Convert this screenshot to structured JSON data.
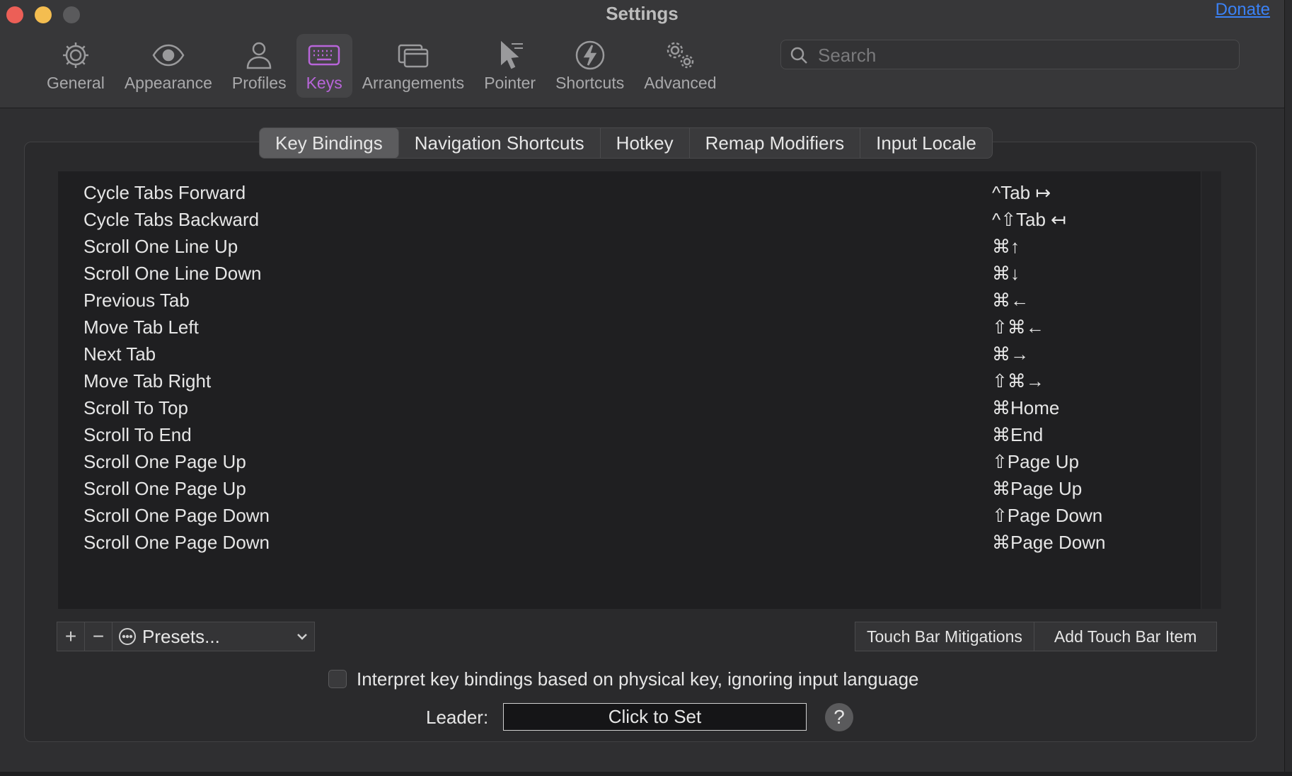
{
  "window": {
    "title": "Settings",
    "donate_label": "Donate"
  },
  "toolbar": {
    "items": [
      {
        "label": "General",
        "icon": "gear-icon"
      },
      {
        "label": "Appearance",
        "icon": "eye-icon"
      },
      {
        "label": "Profiles",
        "icon": "person-icon"
      },
      {
        "label": "Keys",
        "icon": "keyboard-icon",
        "active": true
      },
      {
        "label": "Arrangements",
        "icon": "windows-icon"
      },
      {
        "label": "Pointer",
        "icon": "pointer-icon"
      },
      {
        "label": "Shortcuts",
        "icon": "bolt-icon"
      },
      {
        "label": "Advanced",
        "icon": "gears-icon"
      }
    ],
    "active_color": "#b865d9"
  },
  "search": {
    "placeholder": "Search",
    "value": ""
  },
  "tabs": [
    {
      "label": "Key Bindings",
      "active": true
    },
    {
      "label": "Navigation Shortcuts"
    },
    {
      "label": "Hotkey"
    },
    {
      "label": "Remap Modifiers"
    },
    {
      "label": "Input Locale"
    }
  ],
  "bindings": [
    {
      "action": "Cycle Tabs Forward",
      "keys": "^Tab ↦"
    },
    {
      "action": "Cycle Tabs Backward",
      "keys": "^⇧Tab ↤"
    },
    {
      "action": "Scroll One Line Up",
      "keys": "⌘↑"
    },
    {
      "action": "Scroll One Line Down",
      "keys": "⌘↓"
    },
    {
      "action": "Previous Tab",
      "keys": "⌘←"
    },
    {
      "action": "Move Tab Left",
      "keys": "⇧⌘←"
    },
    {
      "action": "Next Tab",
      "keys": "⌘→"
    },
    {
      "action": "Move Tab Right",
      "keys": "⇧⌘→"
    },
    {
      "action": "Scroll To Top",
      "keys": "⌘Home"
    },
    {
      "action": "Scroll To End",
      "keys": "⌘End"
    },
    {
      "action": "Scroll One Page Up",
      "keys": "⇧Page Up"
    },
    {
      "action": "Scroll One Page Up",
      "keys": "⌘Page Up"
    },
    {
      "action": "Scroll One Page Down",
      "keys": "⇧Page Down"
    },
    {
      "action": "Scroll One Page Down",
      "keys": "⌘Page Down"
    }
  ],
  "controls": {
    "add_label": "+",
    "remove_label": "−",
    "presets_label": "Presets...",
    "touch_bar_mitigations": "Touch Bar Mitigations",
    "add_touch_bar_item": "Add Touch Bar Item",
    "physical_key_checkbox": "Interpret key bindings based on physical key, ignoring input language",
    "physical_key_checked": false,
    "leader_label": "Leader:",
    "leader_button": "Click to Set",
    "help_label": "?"
  }
}
